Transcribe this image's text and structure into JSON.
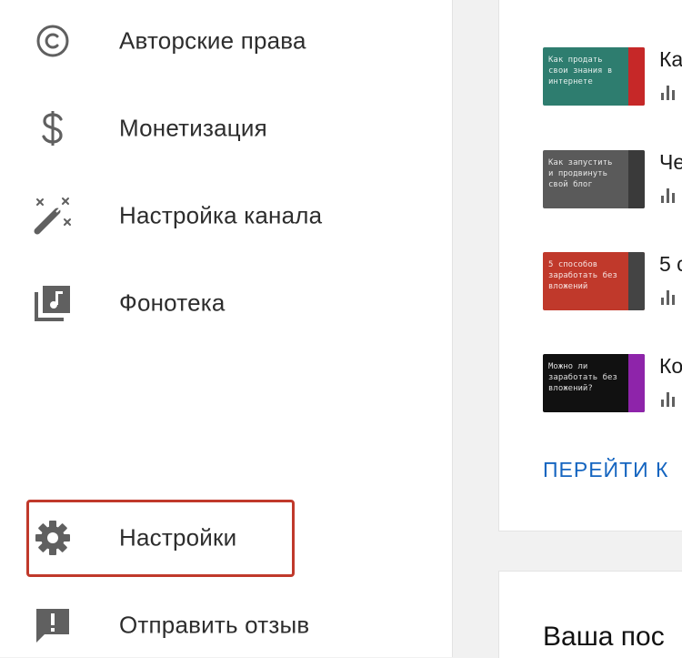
{
  "sidebar": {
    "items": [
      {
        "label": "Авторские права",
        "icon": "copyright-icon"
      },
      {
        "label": "Монетизация",
        "icon": "dollar-icon"
      },
      {
        "label": "Настройка канала",
        "icon": "magic-wand-icon"
      },
      {
        "label": "Фонотека",
        "icon": "audio-library-icon"
      },
      {
        "label": "Настройки",
        "icon": "gear-icon",
        "highlighted": true
      },
      {
        "label": "Отправить отзыв",
        "icon": "feedback-icon"
      }
    ],
    "highlight_color": "#c0392b"
  },
  "videos": [
    {
      "title": "Ка",
      "thumb_text": "Как продать свои знания в интернете",
      "thumb_color": "#2e7d6f",
      "stripe_color": "#c62828"
    },
    {
      "title": "Че",
      "thumb_text": "Как запустить и продвинуть свой блог",
      "thumb_color": "#5a5a5a",
      "stripe_color": "#3a3a3a"
    },
    {
      "title": "5 с",
      "thumb_text": "5 способов заработать без вложений",
      "thumb_color": "#c0392b",
      "stripe_color": "#444444"
    },
    {
      "title": "Ко",
      "thumb_text": "Можно ли заработать без вложений?",
      "thumb_color": "#111111",
      "stripe_color": "#8e24aa"
    }
  ],
  "goto_link": "ПЕРЕЙТИ К",
  "bottom_card_title": "Ваша пос",
  "colors": {
    "link": "#1565c0",
    "icon": "#606060",
    "text": "#2d2d2d"
  }
}
